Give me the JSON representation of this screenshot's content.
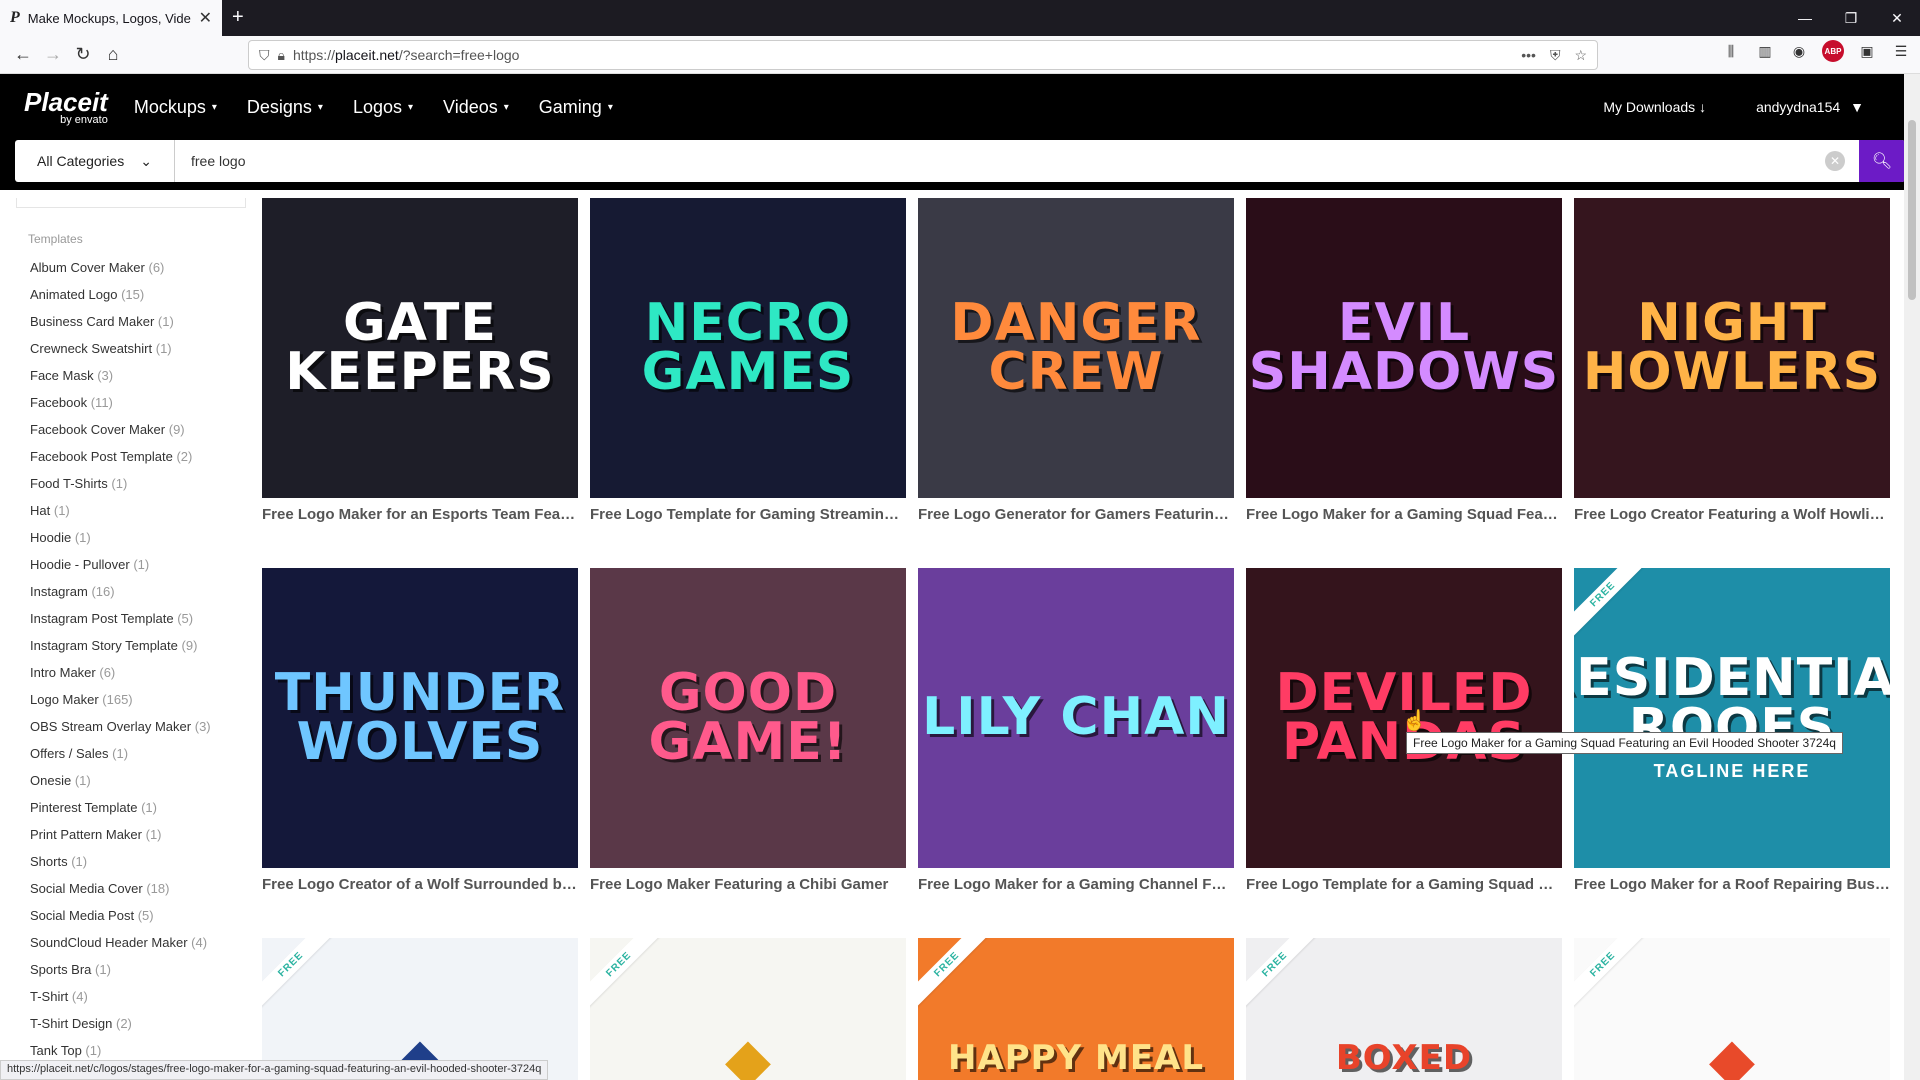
{
  "browser": {
    "tab_title": "Make Mockups, Logos, Videos",
    "tab_favicon": "P",
    "new_tab": "+",
    "url_prefix": "https://",
    "url_domain": "placeit.net",
    "url_rest": "/?search=free+logo"
  },
  "site": {
    "logo_name": "Placeit",
    "logo_by": "by envato",
    "nav": [
      {
        "label": "Mockups"
      },
      {
        "label": "Designs"
      },
      {
        "label": "Logos"
      },
      {
        "label": "Videos"
      },
      {
        "label": "Gaming"
      }
    ],
    "my_downloads": "My Downloads",
    "username": "andyydna154"
  },
  "search": {
    "category": "All Categories",
    "query": "free logo"
  },
  "sidebar": {
    "section": "Templates",
    "items": [
      {
        "label": "Album Cover Maker",
        "count": "(6)"
      },
      {
        "label": "Animated Logo",
        "count": "(15)"
      },
      {
        "label": "Business Card Maker",
        "count": "(1)"
      },
      {
        "label": "Crewneck Sweatshirt",
        "count": "(1)"
      },
      {
        "label": "Face Mask",
        "count": "(3)"
      },
      {
        "label": "Facebook",
        "count": "(11)"
      },
      {
        "label": "Facebook Cover Maker",
        "count": "(9)"
      },
      {
        "label": "Facebook Post Template",
        "count": "(2)"
      },
      {
        "label": "Food T-Shirts",
        "count": "(1)"
      },
      {
        "label": "Hat",
        "count": "(1)"
      },
      {
        "label": "Hoodie",
        "count": "(1)"
      },
      {
        "label": "Hoodie - Pullover",
        "count": "(1)"
      },
      {
        "label": "Instagram",
        "count": "(16)"
      },
      {
        "label": "Instagram Post Template",
        "count": "(5)"
      },
      {
        "label": "Instagram Story Template",
        "count": "(9)"
      },
      {
        "label": "Intro Maker",
        "count": "(6)"
      },
      {
        "label": "Logo Maker",
        "count": "(165)"
      },
      {
        "label": "OBS Stream Overlay Maker",
        "count": "(3)"
      },
      {
        "label": "Offers / Sales",
        "count": "(1)"
      },
      {
        "label": "Onesie",
        "count": "(1)"
      },
      {
        "label": "Pinterest Template",
        "count": "(1)"
      },
      {
        "label": "Print Pattern Maker",
        "count": "(1)"
      },
      {
        "label": "Shorts",
        "count": "(1)"
      },
      {
        "label": "Social Media Cover",
        "count": "(18)"
      },
      {
        "label": "Social Media Post",
        "count": "(5)"
      },
      {
        "label": "SoundCloud Header Maker",
        "count": "(4)"
      },
      {
        "label": "Sports Bra",
        "count": "(1)"
      },
      {
        "label": "T-Shirt",
        "count": "(4)"
      },
      {
        "label": "T-Shirt Design",
        "count": "(2)"
      },
      {
        "label": "Tank Top",
        "count": "(1)"
      }
    ]
  },
  "cards": [
    {
      "art": "GATE KEEPERS",
      "caption": "Free Logo Maker for an Esports Team Featuring a Grim Reaper",
      "bg": "#1e1e28",
      "color": "#ffffff",
      "ribbon": ""
    },
    {
      "art": "NECRO GAMES",
      "caption": "Free Logo Template for Gaming Streaming Channel",
      "bg": "#161a33",
      "color": "#2ee8c4",
      "ribbon": ""
    },
    {
      "art": "DANGER CREW",
      "caption": "Free Logo Generator for Gamers Featuring a Soldier",
      "bg": "#3a3a46",
      "color": "#ff8a3c",
      "ribbon": ""
    },
    {
      "art": "EVIL SHADOWS",
      "caption": "Free Logo Maker for a Gaming Squad Featuring an Evil Hooded Shooter",
      "bg": "#2a0d18",
      "color": "#d48bff",
      "ribbon": ""
    },
    {
      "art": "NIGHT HOWLERS",
      "caption": "Free Logo Creator Featuring a Wolf Howling at the Moon",
      "bg": "#35151e",
      "color": "#ffb347",
      "ribbon": ""
    },
    {
      "art": "THUNDER WOLVES",
      "caption": "Free Logo Creator of a Wolf Surrounded by Thunder",
      "bg": "#14183a",
      "color": "#6fc6ff",
      "ribbon": ""
    },
    {
      "art": "GOOD GAME!",
      "caption": "Free Logo Maker Featuring a Chibi Gamer",
      "bg": "#5a3848",
      "color": "#ff5a8c",
      "ribbon": ""
    },
    {
      "art": "LILY CHAN",
      "caption": "Free Logo Maker for a Gaming Channel Featuring an Anime Girl",
      "bg": "#6a3e9c",
      "color": "#7ef0ff",
      "ribbon": ""
    },
    {
      "art": "DEVILED PANDAS",
      "caption": "Free Logo Template for a Gaming Squad with a Panda",
      "bg": "#34141c",
      "color": "#ff3c64",
      "ribbon": ""
    },
    {
      "art": "RESIDENTIAL ROOFS",
      "sub": "TAGLINE HERE",
      "caption": "Free Logo Maker for a Roof Repairing Business",
      "bg": "#1e8ea8",
      "color": "#ffffff",
      "ribbon": "FREE"
    },
    {
      "art": "",
      "caption": "",
      "bg": "#f1f4f8",
      "color": "#1f3f8a",
      "ribbon": "FREE"
    },
    {
      "art": "",
      "caption": "",
      "bg": "#f6f6f2",
      "color": "#e4a21a",
      "ribbon": "FREE"
    },
    {
      "art": "HAPPY MEAL",
      "caption": "",
      "bg": "#f27a2a",
      "color": "#ffe38a",
      "ribbon": "FREE"
    },
    {
      "art": "BOXED",
      "caption": "",
      "bg": "#efeff1",
      "color": "#e8432a",
      "ribbon": "FREE"
    },
    {
      "art": "",
      "caption": "",
      "bg": "#fafafa",
      "color": "#e84a2a",
      "ribbon": "FREE"
    }
  ],
  "tooltip": "Free Logo Maker for a Gaming Squad Featuring an Evil Hooded Shooter 3724q",
  "status_url": "https://placeit.net/c/logos/stages/free-logo-maker-for-a-gaming-squad-featuring-an-evil-hooded-shooter-3724q"
}
